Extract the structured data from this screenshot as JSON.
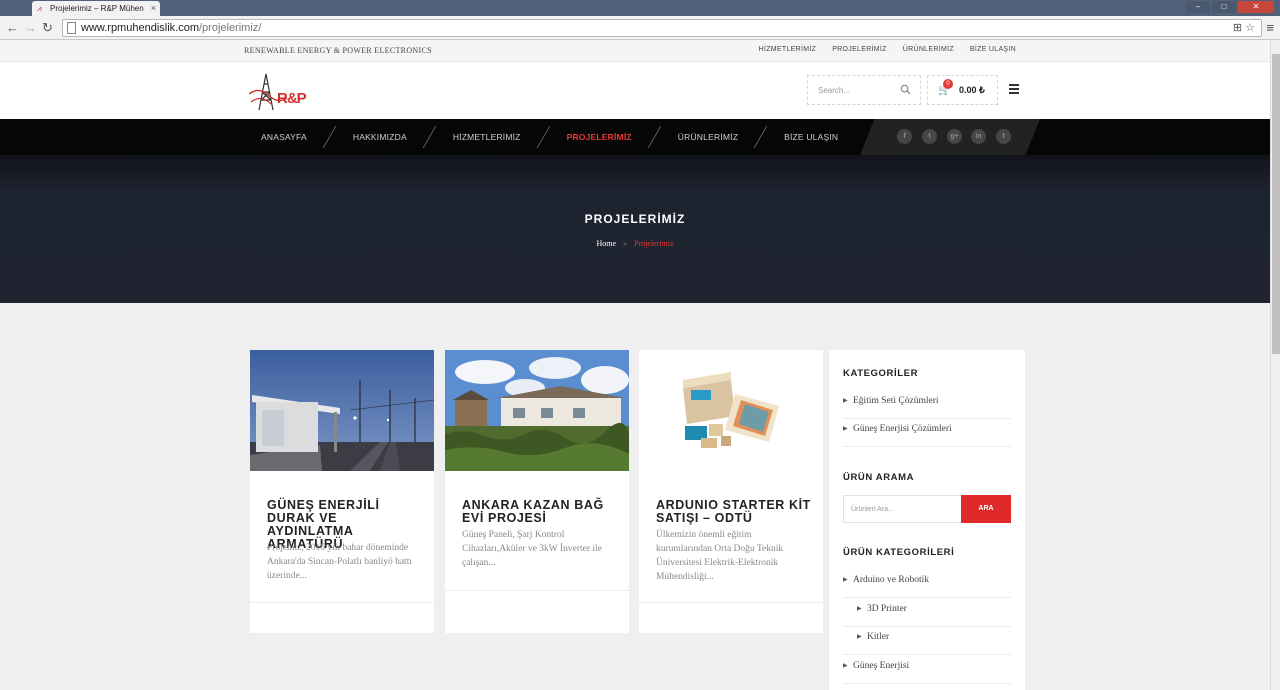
{
  "browser": {
    "tab_title": "Projelerimiz – R&P Mühen",
    "url_host": "www.rpmuhendislik.com",
    "url_path": "/projelerimiz/"
  },
  "topbar": {
    "tagline": "RENEWABLE ENERGY & POWER ELECTRONICS",
    "links": [
      "HİZMETLERİMİZ",
      "PROJELERİMİZ",
      "ÜRÜNLERİMİZ",
      "BİZE ULAŞIN"
    ]
  },
  "header": {
    "logo_text": "R&P",
    "search_placeholder": "Search...",
    "cart_count": "0",
    "cart_total": "0.00 ₺"
  },
  "nav": {
    "items": [
      {
        "label": "ANASAYFA",
        "active": false
      },
      {
        "label": "HAKKIMIZDA",
        "active": false
      },
      {
        "label": "HİZMETLERİMİZ",
        "active": false
      },
      {
        "label": "PROJELERİMİZ",
        "active": true
      },
      {
        "label": "ÜRÜNLERİMİZ",
        "active": false
      },
      {
        "label": "BİZE ULAŞIN",
        "active": false
      }
    ],
    "social": [
      "f",
      "t",
      "g+",
      "in",
      "t"
    ]
  },
  "banner": {
    "title": "PROJELERİMİZ",
    "crumb_home": "Home",
    "crumb_sep": "»",
    "crumb_current": "Projelerimiz"
  },
  "cards": [
    {
      "title": "GÜNEŞ ENERJİLİ DURAK VE AYDINLATMA ARMATÜRÜ",
      "excerpt": "Projemiz, 2016 yılı bahar döneminde Ankara'da Sincan-Polatlı banliyö hattı üzerinde..."
    },
    {
      "title": "ANKARA KAZAN BAĞ EVİ PROJESİ",
      "excerpt": "Güneş Paneli, Şarj Kontrol Cihazları,Aküler ve 3kW İnverter ile çalışan..."
    },
    {
      "title": "ARDUNIO STARTER KİT SATIŞI – ODTÜ",
      "excerpt": "Ülkemizin önemli eğitim kurumlarından Orta Doğu Teknik Üniversitesi Elektrik-Elektronik Mühendisliği..."
    }
  ],
  "sidebar": {
    "categories_title": "KATEGORİLER",
    "categories": [
      "Eğitim Seti Çözümleri",
      "Güneş Enerjisi Çözümleri"
    ],
    "search_title": "ÜRÜN ARAMA",
    "search_placeholder": "Ürünleri Ara...",
    "search_button": "ARA",
    "product_cats_title": "ÜRÜN KATEGORİLERİ",
    "product_cats": [
      {
        "label": "Arduino ve Robotik",
        "level": 0
      },
      {
        "label": "3D Printer",
        "level": 1
      },
      {
        "label": "Kitler",
        "level": 1
      },
      {
        "label": "Güneş Enerjisi",
        "level": 0
      }
    ]
  },
  "colors": {
    "accent": "#e53935",
    "nav_bg": "#060606",
    "banner_bg": "#1f2430"
  }
}
